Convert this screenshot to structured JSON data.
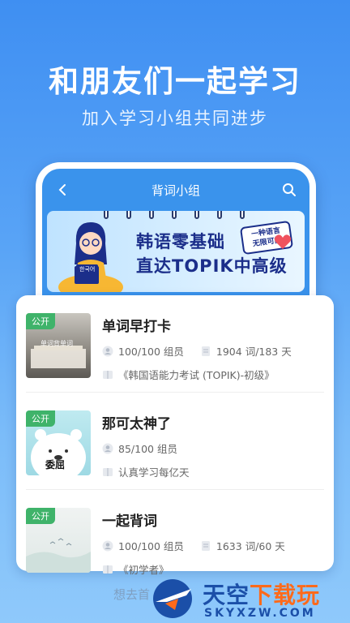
{
  "hero": {
    "title": "和朋友们一起学习",
    "subtitle": "加入学习小组共同进步"
  },
  "phone": {
    "header_title": "背词小组",
    "banner": {
      "line1": "韩语零基础",
      "line2": "直达TOPIK中高级",
      "tag_line1": "一种语言",
      "tag_line2": "无限可能",
      "book_label": "한국어"
    }
  },
  "groups": [
    {
      "badge": "公开",
      "thumb_caption": "单词背单词",
      "title": "单词早打卡",
      "members": "100/100 组员",
      "words": "1904 词/183 天",
      "book": "《韩国语能力考试 (TOPIK)-初级》"
    },
    {
      "badge": "公开",
      "thumb_caption": "委屈",
      "title": "那可太神了",
      "members": "85/100 组员",
      "words": "",
      "book": "认真学习每亿天"
    },
    {
      "badge": "公开",
      "thumb_caption": "",
      "title": "一起背词",
      "members": "100/100 组员",
      "words": "1633 词/60 天",
      "book": "《初学者》"
    }
  ],
  "peek_text": "想去首",
  "watermark": {
    "main_a": "天空",
    "main_b": "下载玩",
    "sub": "SKYXZW.COM"
  },
  "colors": {
    "background_top": "#3f8ff2",
    "public_badge": "#3fb36a",
    "banner_text": "#1b2e8a"
  }
}
